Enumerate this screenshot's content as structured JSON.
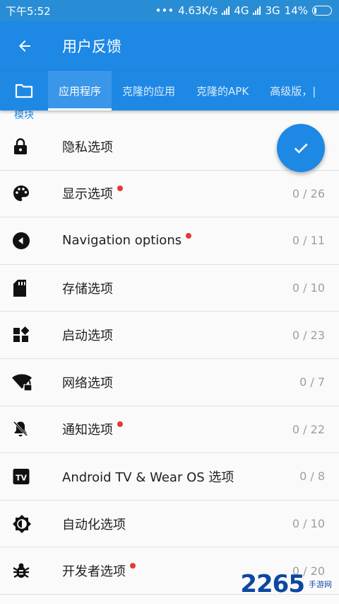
{
  "status_bar": {
    "time": "下午5:52",
    "net_speed": "4.63K/s",
    "net1": "4G",
    "net2": "3G",
    "battery": "14%"
  },
  "app_bar": {
    "title": "用户反馈",
    "back_icon": "arrow-back-icon"
  },
  "tabs": [
    {
      "label": "应用程序",
      "active": true
    },
    {
      "label": "克隆的应用",
      "active": false
    },
    {
      "label": "克隆的APK",
      "active": false
    },
    {
      "label": "高级版，|",
      "active": false
    }
  ],
  "section_header": "模块",
  "items": [
    {
      "label": "隐私选项",
      "count": "",
      "icon": "lock-icon",
      "dot": false
    },
    {
      "label": "显示选项",
      "count": "0 / 26",
      "icon": "palette-icon",
      "dot": true
    },
    {
      "label": "Navigation options",
      "count": "0 / 11",
      "icon": "navigation-back-icon",
      "dot": true
    },
    {
      "label": "存储选项",
      "count": "0 / 10",
      "icon": "sd-card-icon",
      "dot": false
    },
    {
      "label": "启动选项",
      "count": "0 / 23",
      "icon": "widgets-icon",
      "dot": false
    },
    {
      "label": "网络选项",
      "count": "0 / 7",
      "icon": "wifi-lock-icon",
      "dot": false
    },
    {
      "label": "通知选项",
      "count": "0 / 22",
      "icon": "notifications-off-icon",
      "dot": true
    },
    {
      "label": "Android TV & Wear OS 选项",
      "count": "0 / 8",
      "icon": "tv-icon",
      "dot": false
    },
    {
      "label": "自动化选项",
      "count": "0 / 10",
      "icon": "brightness-icon",
      "dot": false
    },
    {
      "label": "开发者选项",
      "count": "0 / 20",
      "icon": "bug-icon",
      "dot": true
    }
  ],
  "fab": {
    "icon": "check-icon"
  },
  "watermark": {
    "number": "2265",
    "sub": "手游网"
  },
  "colors": {
    "primary": "#1e88e5",
    "accent_dot": "#e53935",
    "text": "#212121",
    "muted": "#9e9e9e"
  }
}
